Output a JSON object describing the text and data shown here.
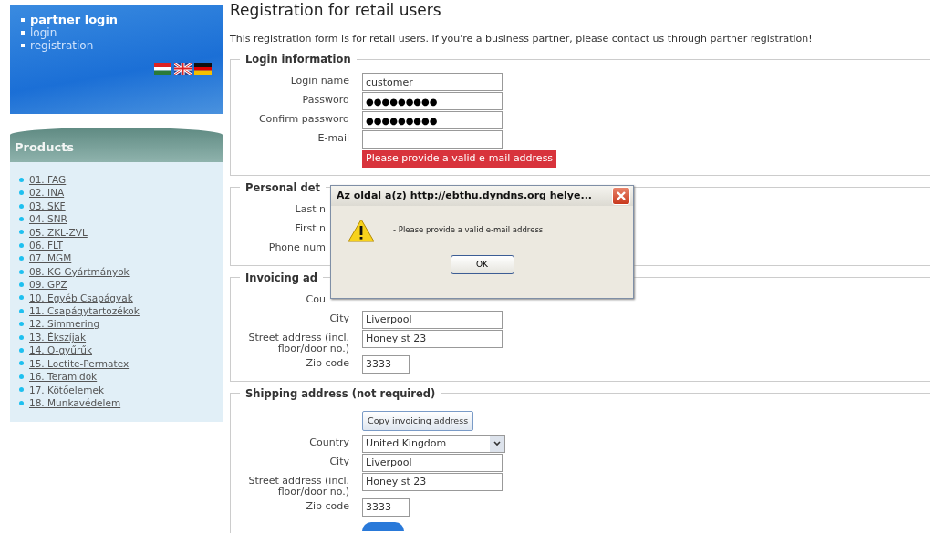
{
  "sidebar": {
    "top_links": [
      {
        "label": "partner login",
        "bold": true
      },
      {
        "label": "login",
        "bold": false
      },
      {
        "label": "registration",
        "bold": false
      }
    ],
    "products_title": "Products",
    "products": [
      "01. FAG",
      "02. INA",
      "03. SKF",
      "04. SNR",
      "05. ZKL-ZVL",
      "06. FLT",
      "07. MGM",
      "08. KG Gyártmányok",
      "09. GPZ",
      "10. Egyéb Csapágyak",
      "11. Csapágytartozékok",
      "12. Simmering",
      "13. Ékszíjak",
      "14. O-gyűrűk",
      "15. Loctite-Permatex",
      "16. Teramidok",
      "17. Kötőelemek",
      "18. Munkavédelem"
    ]
  },
  "page": {
    "title": "Registration for retail users",
    "intro": "This registration form is for retail users. If you're a business partner, please contact us through partner registration!"
  },
  "sections": [
    {
      "legend": "Login information",
      "fields": [
        {
          "kind": "text",
          "label": "Login name",
          "value": "customer"
        },
        {
          "kind": "password",
          "label": "Password",
          "value": "●●●●●●●●●"
        },
        {
          "kind": "password",
          "label": "Confirm password",
          "value": "●●●●●●●●●"
        },
        {
          "kind": "text",
          "label": "E-mail",
          "error": "Please provide a valid e-mail address"
        }
      ]
    },
    {
      "legend": "Personal det",
      "fields": [
        {
          "kind": "hidden",
          "label": "Last n"
        },
        {
          "kind": "hidden",
          "label": "First n"
        },
        {
          "kind": "hidden",
          "label": "Phone num"
        }
      ]
    },
    {
      "legend": "Invoicing ad",
      "fields": [
        {
          "kind": "hidden",
          "label": "Cou"
        },
        {
          "kind": "text",
          "label": "City",
          "value": "Liverpool"
        },
        {
          "kind": "text",
          "label": "Street address (incl. floor/door no.)",
          "value": "Honey st 23"
        },
        {
          "kind": "short",
          "label": "Zip code",
          "value": "3333"
        }
      ]
    },
    {
      "legend": "Shipping address (not required)",
      "fields": [
        {
          "kind": "button",
          "label": "Copy invoicing address"
        },
        {
          "kind": "select",
          "label": "Country",
          "value": "United Kingdom"
        },
        {
          "kind": "text",
          "label": "City",
          "value": "Liverpool"
        },
        {
          "kind": "text",
          "label": "Street address (incl. floor/door no.)",
          "value": "Honey st 23"
        },
        {
          "kind": "short",
          "label": "Zip code",
          "value": "3333"
        }
      ]
    }
  ],
  "dialog": {
    "title": "Az oldal a(z) http://ebthu.dyndns.org helye...",
    "message": "- Please provide a valid e-mail address",
    "button": "OK"
  }
}
